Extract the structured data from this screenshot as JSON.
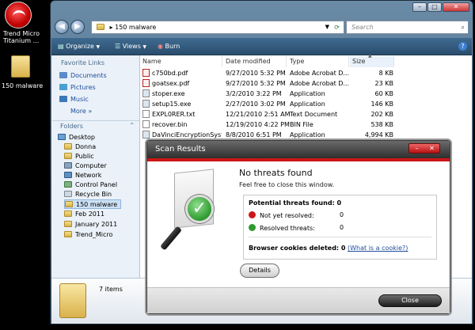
{
  "desktop": {
    "icons": [
      {
        "label_line1": "Trend Micro",
        "label_line2": "Titanium ..."
      },
      {
        "label": "150 malware"
      }
    ]
  },
  "explorer": {
    "address": "150 malware",
    "search_placeholder": "Search",
    "toolbar": {
      "organize": "Organize",
      "views": "Views",
      "burn": "Burn"
    },
    "favorite_links_title": "Favorite Links",
    "favorite_links": [
      "Documents",
      "Pictures",
      "Music"
    ],
    "more_label": "More",
    "folders_title": "Folders",
    "folders": [
      "Desktop",
      "Donna",
      "Public",
      "Computer",
      "Network",
      "Control Panel",
      "Recycle Bin",
      "150 malware",
      "Feb 2011",
      "January 2011",
      "Trend_Micro"
    ],
    "columns": [
      "Name",
      "Date modified",
      "Type",
      "Size"
    ],
    "files": [
      {
        "name": "c750bd.pdf",
        "date": "9/27/2010 5:32 PM",
        "type": "Adobe Acrobat D...",
        "size": "8 KB"
      },
      {
        "name": "goatsex.pdf",
        "date": "9/27/2010 5:32 PM",
        "type": "Adobe Acrobat D...",
        "size": "23 KB"
      },
      {
        "name": "stoper.exe",
        "date": "3/2/2010 3:22 PM",
        "type": "Application",
        "size": "60 KB"
      },
      {
        "name": "setup15.exe",
        "date": "2/27/2010 3:02 PM",
        "type": "Application",
        "size": "146 KB"
      },
      {
        "name": "EXPL0RER.txt",
        "date": "12/21/2010 2:51 AM",
        "type": "Text Document",
        "size": "202 KB"
      },
      {
        "name": "recover.bin",
        "date": "12/19/2010 4:22 PM",
        "type": "BIN File",
        "size": "538 KB"
      },
      {
        "name": "DaVinciEncryptionSyst...",
        "date": "8/8/2010 6:51 PM",
        "type": "Application",
        "size": "4,994 KB"
      }
    ],
    "item_count": "7 items"
  },
  "dialog": {
    "title": "Scan Results",
    "heading": "No threats found",
    "subheading": "Feel free to close this window.",
    "potential_threats": "Potential threats found: 0",
    "not_yet_resolved_label": "Not yet resolved:",
    "not_yet_resolved_value": "0",
    "resolved_label": "Resolved threats:",
    "resolved_value": "0",
    "cookies_label": "Browser cookies deleted: 0",
    "cookie_link": "(What is a cookie?)",
    "details_button": "Details",
    "close_button": "Close",
    "colors": {
      "accent": "#cc1717",
      "resolved": "#2e9a2e",
      "unresolved": "#cc1717"
    }
  }
}
